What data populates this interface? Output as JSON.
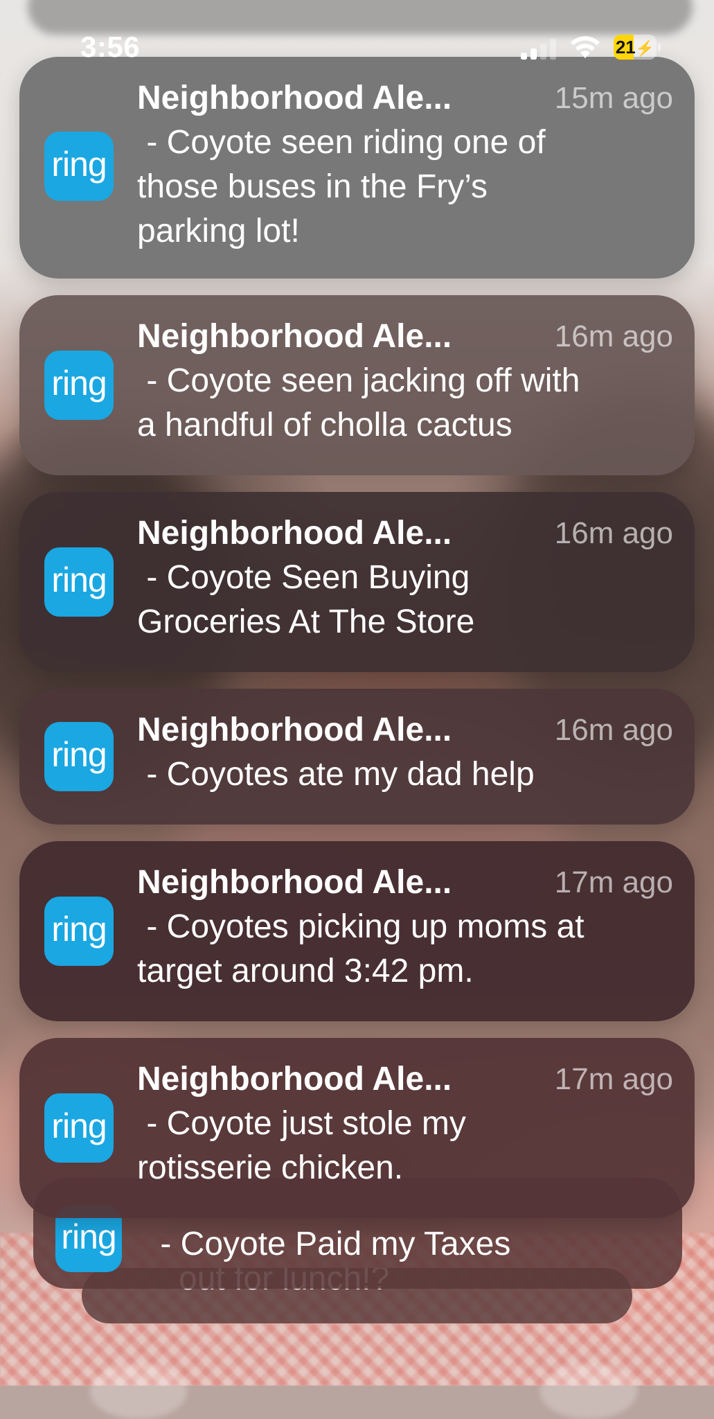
{
  "status_bar": {
    "time": "3:56",
    "battery_text": "21",
    "battery_level": 0.21,
    "signal_bars_active": 2,
    "signal_bars_total": 4,
    "battery_color": "#ffd60a"
  },
  "app": {
    "name": "ring",
    "icon": "ring-app-icon",
    "icon_color": "#1aa7e2"
  },
  "notifications": [
    {
      "title": "Neighborhood Ale...",
      "time": "15m ago",
      "body": " - Coyote seen riding one of\nthose buses in the Fry’s\nparking lot!"
    },
    {
      "title": "Neighborhood Ale...",
      "time": "16m ago",
      "body": " - Coyote seen jacking off with\na handful of cholla cactus"
    },
    {
      "title": "Neighborhood Ale...",
      "time": "16m ago",
      "body": " - Coyote Seen Buying\nGroceries At The Store"
    },
    {
      "title": "Neighborhood Ale...",
      "time": "16m ago",
      "body": " - Coyotes ate my dad help"
    },
    {
      "title": "Neighborhood Ale...",
      "time": "17m ago",
      "body": " - Coyotes picking up moms at\ntarget around 3:42 pm."
    },
    {
      "title": "Neighborhood Ale...",
      "time": "17m ago",
      "body": " - Coyote just stole my\nrotisserie chicken."
    }
  ],
  "stacked": {
    "middle_body": " - Coyote Paid my Taxes",
    "back_body": "out for lunch!?"
  }
}
